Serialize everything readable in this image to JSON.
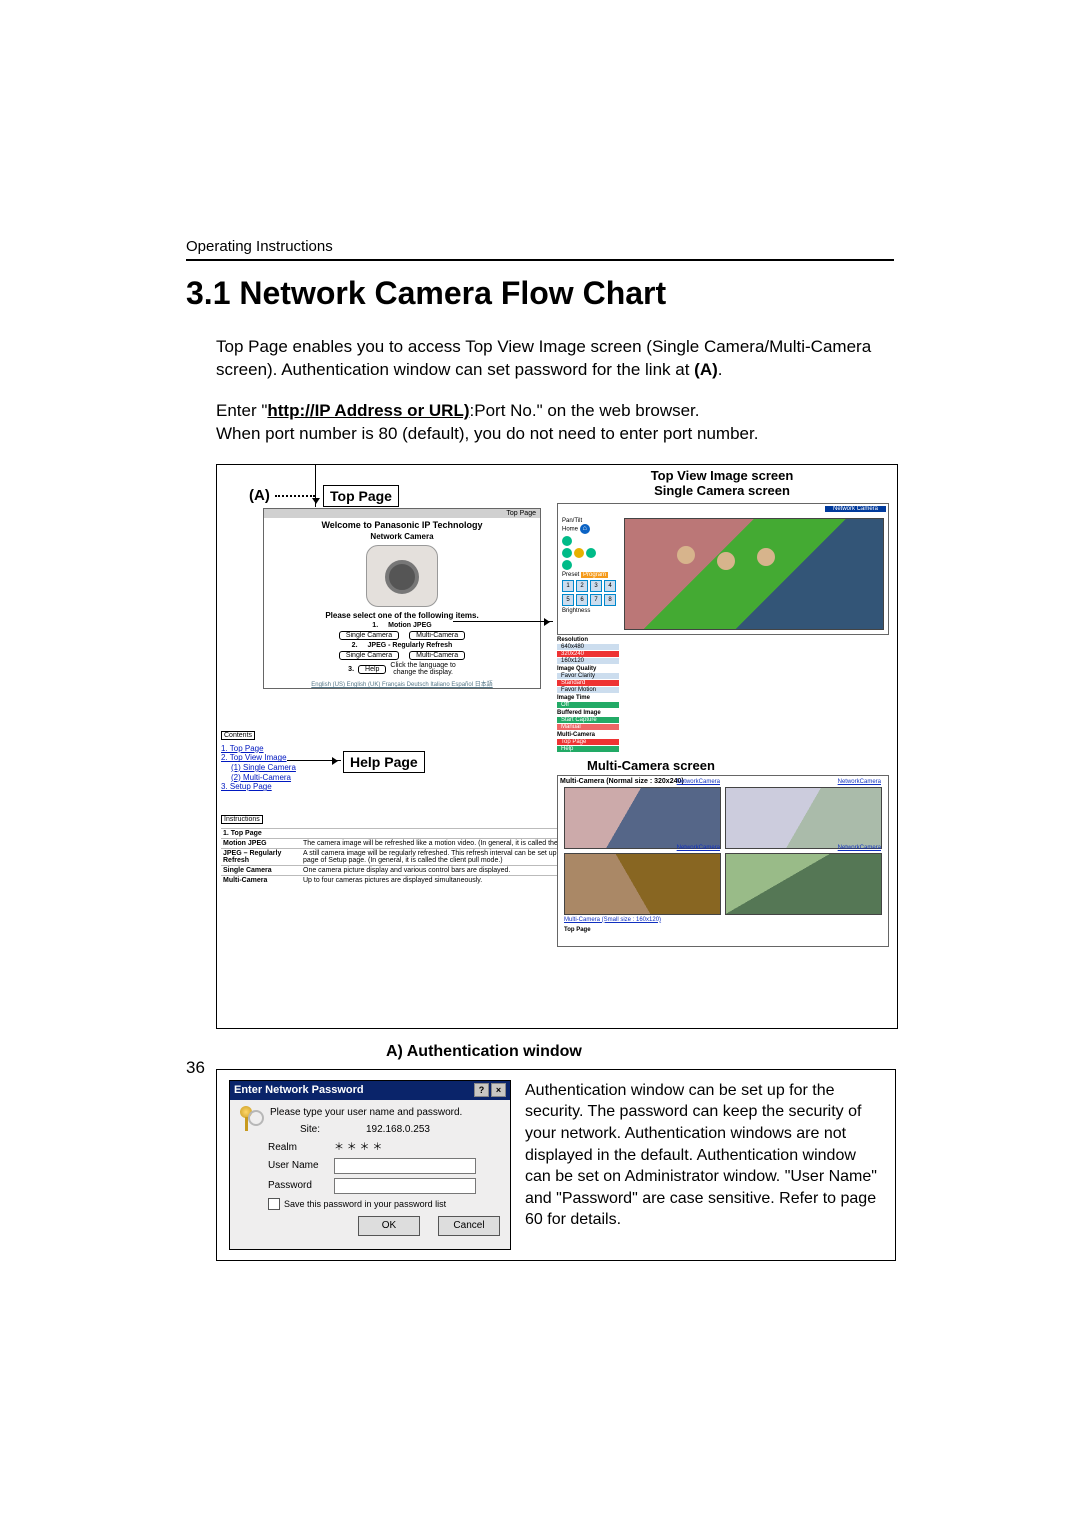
{
  "header": {
    "running": "Operating Instructions"
  },
  "title": "3.1   Network Camera Flow Chart",
  "intro1": "Top Page enables you to access Top View Image screen (Single Camera/Multi-Camera screen). Authentication window can set password for the link at ",
  "intro1_bold": "(A)",
  "intro1_end": ".",
  "intro2_a": "Enter \"",
  "intro2_bold": "http://IP Address or URL)",
  "intro2_b": ":Port No.\" on the web browser.",
  "intro2_line2": "When port number is 80 (default), you do not need to enter port number.",
  "flow": {
    "a_label": "(A)",
    "top_page_box": "Top Page",
    "help_page_box": "Help Page",
    "tp_bar": "Top Page",
    "welcome": "Welcome to Panasonic IP Technology",
    "nc": "Network Camera",
    "pick": "Please select one of the following items.",
    "n1": "1.",
    "n1_lbl": "Motion JPEG",
    "n2": "2.",
    "n2_lbl": "JPEG - Regularly Refresh",
    "n3": "3.",
    "n3_lbl": "Help",
    "single": "Single Camera",
    "multi": "Multi-Camera",
    "lang_note1": "Click the language to",
    "lang_note2": "change the display.",
    "lang_strip": "English (US) English (UK) Français Deutsch Italiano Español 日本語",
    "contents_head": "Contents",
    "c1": "1. Top Page",
    "c2": "2. Top View Image",
    "c2a": "(1) Single Camera",
    "c2b": "(2) Multi-Camera",
    "c3": "3. Setup Page",
    "instr_head": "Instructions",
    "instr": [
      {
        "c1": "1. Top Page",
        "c2": ""
      },
      {
        "c1": "Motion JPEG",
        "c2": "The camera image will be refreshed like a motion video. (In general, it is called the server push mode.)"
      },
      {
        "c1": "JPEG – Regularly Refresh",
        "c2": "A still camera image will be regularly refreshed. This refresh interval can be set up at Top View Image page of Setup page. (In general, it is called the client pull mode.)"
      },
      {
        "c1": "Single Camera",
        "c2": "One camera picture display and various control bars are displayed."
      },
      {
        "c1": "Multi-Camera",
        "c2": "Up to four cameras pictures are displayed simultaneously."
      }
    ],
    "right_title1": "Top View Image screen",
    "right_title2": "Single Camera screen",
    "multi_title": "Multi-Camera screen",
    "net_cam": "Network Camera",
    "pantilt": "Pan/Tilt",
    "home": "Home",
    "preset": "Preset",
    "program": "Program",
    "bright": "Brightness",
    "resolution": "Resolution",
    "r1": "640x480",
    "r2": "320x240",
    "r3": "160x120",
    "iq": "Image Quality",
    "iq1": "Favor Clarity",
    "iq2": "Standard",
    "iq3": "Favor Motion",
    "imgtime": "Image Time",
    "buf": "Buffered Image",
    "buf1": "Start Capture",
    "buf2": "Manual",
    "mcl": "Multi-Camera",
    "mc1": "Top Page",
    "mc2": "Help",
    "mc_head": "Multi-Camera (Normal size : 320x240)",
    "mc_cap": "NetworkCamera",
    "mc_foot1": "Multi-Camera (Small size : 160x120)",
    "mc_foot2": "Top Page"
  },
  "auth": {
    "heading": "A) Authentication window",
    "dlg_title": "Enter Network Password",
    "msg": "Please type your user name and password.",
    "site_l": "Site:",
    "site_v": "192.168.0.253",
    "realm_l": "Realm",
    "realm_v": "＊ ＊ ＊ ＊",
    "user_l": "User Name",
    "pass_l": "Password",
    "save": "Save this password in your password list",
    "ok": "OK",
    "cancel": "Cancel",
    "para": "Authentication window can be set up for the security. The password can keep the security of your network. Authentication windows are not displayed in the default. Authentication window can be set on Administrator window. \"User Name\" and \"Password\" are case sensitive. Refer to page 60 for details."
  },
  "page_number": "36"
}
